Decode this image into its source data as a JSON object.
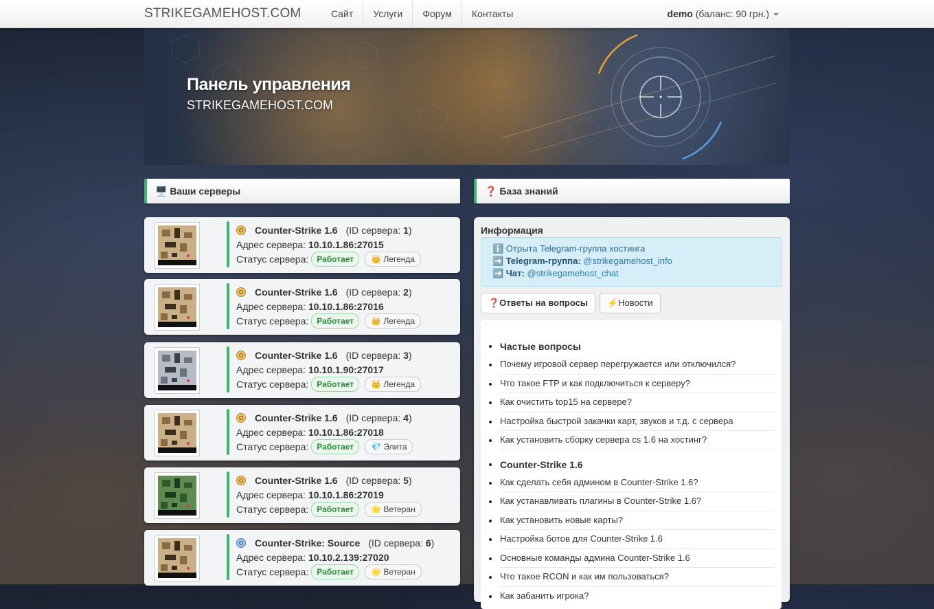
{
  "navbar": {
    "brand": "STRIKEGAMEHOST.COM",
    "links": [
      "Сайт",
      "Услуги",
      "Форум",
      "Контакты"
    ],
    "user": "demo",
    "balance": "(баланс: 90 грн.)"
  },
  "banner": {
    "title": "Панель управления",
    "subtitle": "STRIKEGAMEHOST.COM"
  },
  "servers_panel": {
    "heading": "🖥️ Ваши серверы"
  },
  "kb_panel": {
    "heading": "❓ База знаний"
  },
  "server_labels": {
    "id_prefix": "(ID сервера: ",
    "id_suffix": ")",
    "address_label": "Адрес сервера:",
    "status_label": "Статус сервера:"
  },
  "servers": [
    {
      "game": "Counter-Strike 1.6",
      "id": "1",
      "address": "10.10.1.86:27015",
      "status": "Работает",
      "tier": "👑 Легенда",
      "icon": "cs-icon",
      "map": "desert"
    },
    {
      "game": "Counter-Strike 1.6",
      "id": "2",
      "address": "10.10.1.86:27016",
      "status": "Работает",
      "tier": "👑 Легенда",
      "icon": "cs-icon",
      "map": "desert"
    },
    {
      "game": "Counter-Strike 1.6",
      "id": "3",
      "address": "10.10.1.90:27017",
      "status": "Работает",
      "tier": "👑 Легенда",
      "icon": "cs-icon",
      "map": "snow"
    },
    {
      "game": "Counter-Strike 1.6",
      "id": "4",
      "address": "10.10.1.86:27018",
      "status": "Работает",
      "tier": "💎 Элита",
      "icon": "cs-icon",
      "map": "desert"
    },
    {
      "game": "Counter-Strike 1.6",
      "id": "5",
      "address": "10.10.1.86:27019",
      "status": "Работает",
      "tier": "🌟 Ветеран",
      "icon": "cs-icon",
      "map": "green"
    },
    {
      "game": "Counter-Strike: Source",
      "id": "6",
      "address": "10.10.2.139:27020",
      "status": "Работает",
      "tier": "🌟 Ветеран",
      "icon": "css-icon",
      "map": "desert"
    }
  ],
  "info": {
    "title": "Информация",
    "line1": "ℹ️ Отрыта Telegram-группа хостинга",
    "line2_label": "➡️ Telegram-группа:",
    "line2_link": "@strikegamehost_info",
    "line3_label": "➡️ Чат:",
    "line3_link": "@strikegamehost_chat"
  },
  "kb_tabs": [
    "❓Ответы на вопросы",
    "⚡Новости"
  ],
  "kb_sections": [
    {
      "title": "Частые вопросы",
      "items": [
        "Почему игровой сервер перегружается или отключился?",
        "Что такое FTP и как подключиться к серверу?",
        "Как очистить top15 на сервере?",
        "Настройка быстрой закачки карт, звуков и т.д. с сервера",
        "Как установить сборку сервера cs 1.6 на хостинг?"
      ]
    },
    {
      "title": "Counter-Strike 1.6",
      "items": [
        "Как сделать себя админом в Counter-Strike 1.6?",
        "Как устанавливать плагины в Counter-Strike 1.6?",
        "Как установить новые карты?",
        "Настройка ботов для Counter-Strike 1.6",
        "Основные команды админа Counter-Strike 1.6",
        "Что такое RCON и как им пользоваться?",
        "Как забанить игрока?"
      ]
    }
  ],
  "colors": {
    "accent": "#3cb46c",
    "status_text": "#2e8b3e",
    "info_bg": "#d6eef8"
  }
}
